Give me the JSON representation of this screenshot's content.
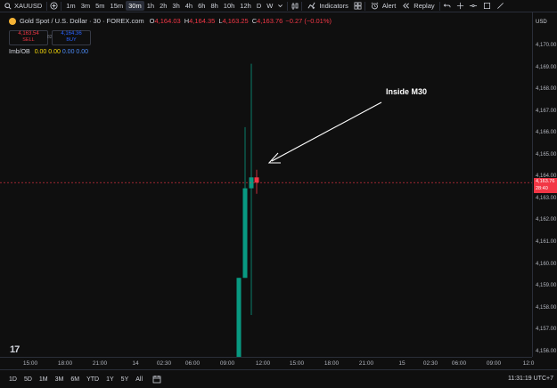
{
  "toolbar": {
    "symbol": "XAUUSD",
    "timeframes": [
      "1m",
      "3m",
      "5m",
      "15m",
      "30m",
      "1h",
      "2h",
      "3h",
      "4h",
      "6h",
      "8h",
      "10h",
      "12h",
      "D",
      "W"
    ],
    "active_timeframe": "30m",
    "indicators_label": "Indicators",
    "alert_label": "Alert",
    "replay_label": "Replay"
  },
  "legend": {
    "title": "Gold Spot / U.S. Dollar · 30 · FOREX.com",
    "o_label": "O",
    "o_value": "4,164.03",
    "h_label": "H",
    "h_value": "4,164.35",
    "l_label": "L",
    "l_value": "4,163.25",
    "c_label": "C",
    "c_value": "4,163.76",
    "change": "−0.27 (−0.01%)"
  },
  "trade": {
    "sell_price": "4,163.54",
    "sell_label": "SELL",
    "spread": "82",
    "buy_price": "4,164.36",
    "buy_label": "BUY"
  },
  "indicator": {
    "name": "Imb/OB",
    "v1": "0.00",
    "v2": "0.00",
    "v3": "0.00",
    "v4": "0.00"
  },
  "annotation": "Inside M30",
  "price_axis": {
    "currency": "USD",
    "labels": [
      "4,170.00",
      "4,169.00",
      "4,168.00",
      "4,167.00",
      "4,166.00",
      "4,165.00",
      "4,164.00",
      "4,163.00",
      "4,162.00",
      "4,161.00",
      "4,160.00",
      "4,159.00",
      "4,158.00",
      "4,157.00",
      "4,156.00"
    ],
    "current_price": "4,163.76",
    "countdown": "28:40"
  },
  "time_axis": [
    "15:00",
    "18:00",
    "21:00",
    "14",
    "02:30",
    "06:00",
    "09:00",
    "12:00",
    "15:00",
    "18:00",
    "21:00",
    "15",
    "02:30",
    "06:00",
    "09:00",
    "12:0"
  ],
  "bottom": {
    "ranges": [
      "1D",
      "5D",
      "1M",
      "3M",
      "6M",
      "YTD",
      "1Y",
      "5Y",
      "All"
    ],
    "clock": "11:31:19 UTC+7"
  },
  "colors": {
    "up": "#089981",
    "down": "#f23645",
    "accent": "#2962ff"
  },
  "chart_data": {
    "type": "candlestick",
    "candles": [
      {
        "open": 4155.6,
        "high": 4159.4,
        "low": 4155.6,
        "close": 4159.4
      },
      {
        "open": 4159.4,
        "high": 4166.3,
        "low": 4159.4,
        "close": 4163.5
      },
      {
        "open": 4163.5,
        "high": 4169.2,
        "low": 4157.7,
        "close": 4164.0
      },
      {
        "open": 4164.0,
        "high": 4164.35,
        "low": 4163.25,
        "close": 4163.76
      }
    ]
  }
}
